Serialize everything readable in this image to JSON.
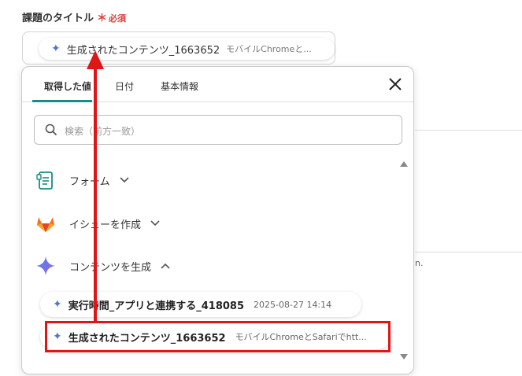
{
  "field": {
    "label": "課題のタイトル",
    "required_mark": "＊",
    "required_text": "必須",
    "value_main": "生成されたコンテンツ_1663652",
    "value_sub": "モバイルChromeと..."
  },
  "background": {
    "cut_text": "n."
  },
  "panel": {
    "tabs": [
      {
        "label": "取得した値",
        "active": true
      },
      {
        "label": "日付",
        "active": false
      },
      {
        "label": "基本情報",
        "active": false
      }
    ],
    "search_placeholder": "検索（前方一致）",
    "sections": [
      {
        "label": "フォーム",
        "icon": "form-icon",
        "expanded": false
      },
      {
        "label": "イシューを作成",
        "icon": "gitlab-icon",
        "expanded": false
      },
      {
        "label": "コンテンツを生成",
        "icon": "gemini-sparkle-icon",
        "expanded": true
      }
    ],
    "items": [
      {
        "main": "実行時間_アプリと連携する_418085",
        "sub": "2025-08-27 14:14"
      },
      {
        "main": "生成されたコンテンツ_1663652",
        "sub": "モバイルChromeとSafariでhtt..."
      }
    ]
  },
  "colors": {
    "accent": "#1a8a8a",
    "required": "#e03a3a",
    "highlight": "#e01515"
  }
}
